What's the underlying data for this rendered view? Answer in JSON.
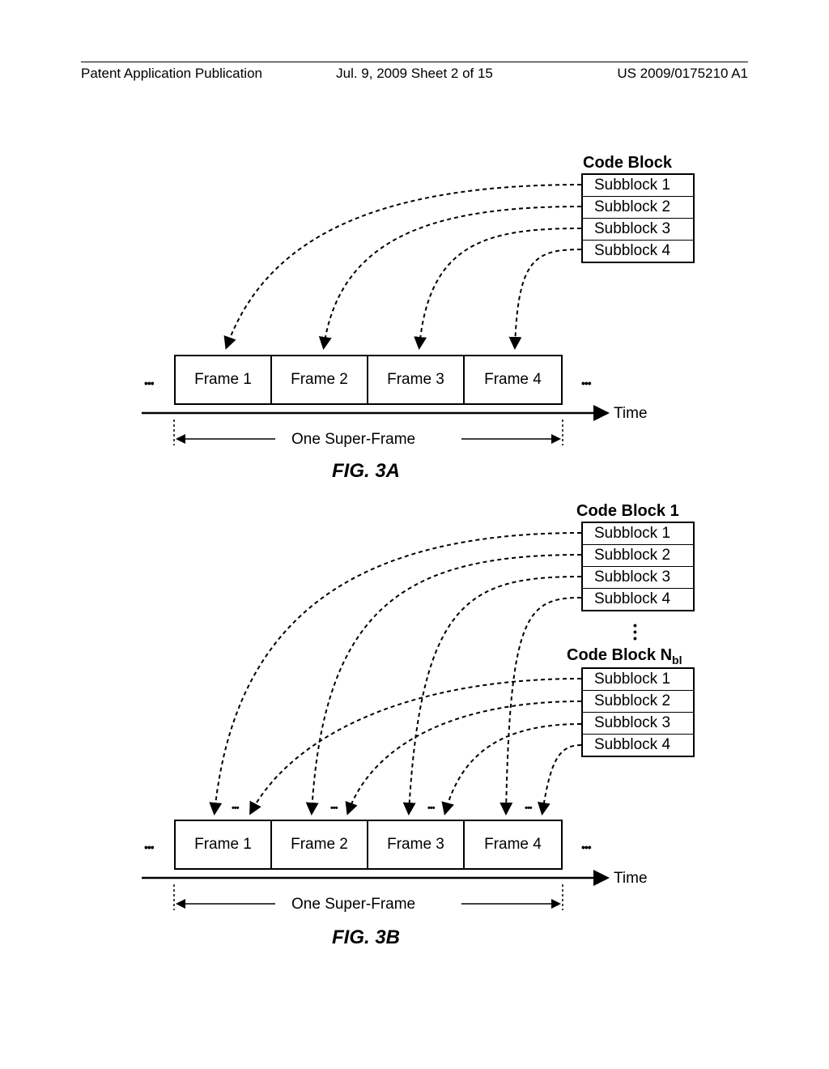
{
  "header": {
    "left": "Patent Application Publication",
    "mid": "Jul. 9, 2009  Sheet 2 of 15",
    "right": "US 2009/0175210 A1"
  },
  "figA": {
    "codeBlockTitle": "Code Block",
    "subblocks": [
      "Subblock 1",
      "Subblock 2",
      "Subblock 3",
      "Subblock 4"
    ],
    "frames": [
      "Frame 1",
      "Frame 2",
      "Frame 3",
      "Frame 4"
    ],
    "timeLabel": "Time",
    "superFrameLabel": "One Super-Frame",
    "caption": "FIG. 3A",
    "dots": "•••"
  },
  "figB": {
    "codeBlockTitle1": "Code Block 1",
    "codeBlockTitleN": "Code Block N",
    "codeBlockTitleNsub": "bl",
    "subblocks1": [
      "Subblock 1",
      "Subblock 2",
      "Subblock 3",
      "Subblock 4"
    ],
    "subblocksN": [
      "Subblock 1",
      "Subblock 2",
      "Subblock 3",
      "Subblock 4"
    ],
    "frames": [
      "Frame 1",
      "Frame 2",
      "Frame 3",
      "Frame 4"
    ],
    "timeLabel": "Time",
    "superFrameLabel": "One Super-Frame",
    "caption": "FIG. 3B",
    "dots": "•••"
  }
}
